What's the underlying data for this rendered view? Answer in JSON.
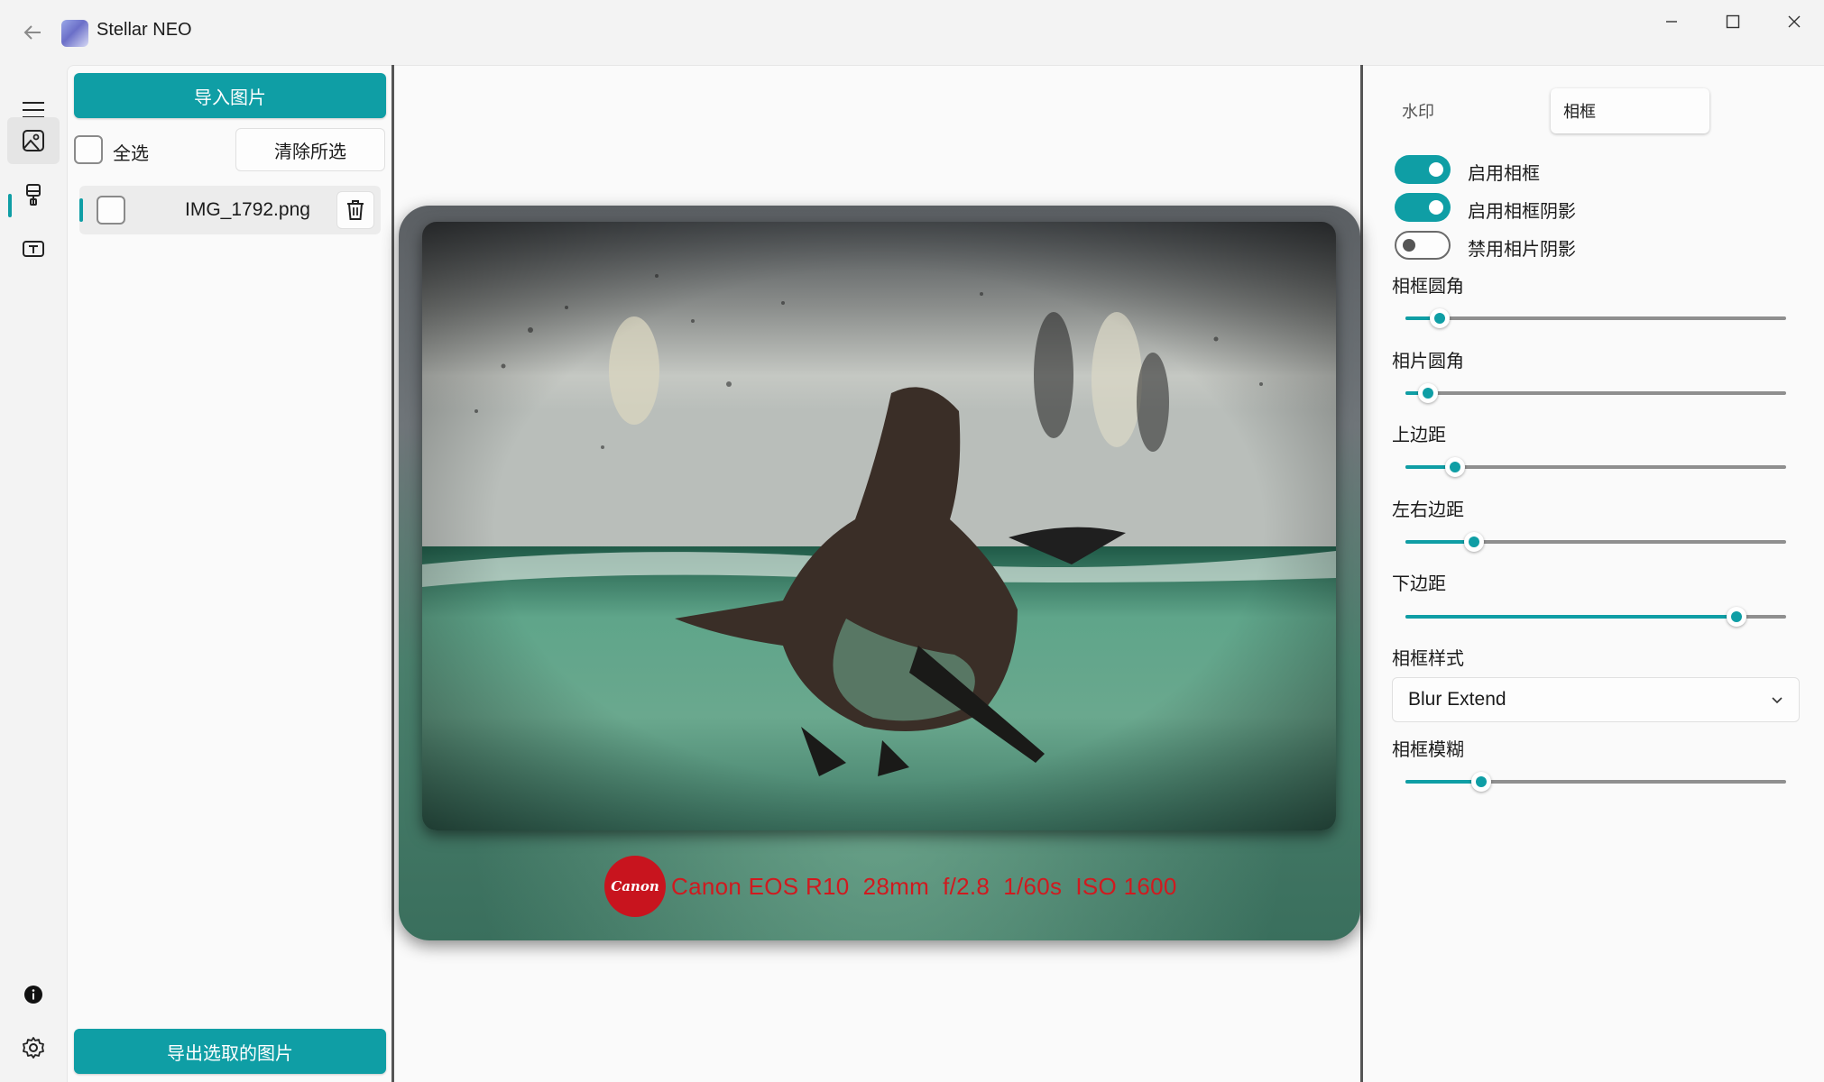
{
  "titlebar": {
    "app_title": "Stellar NEO",
    "icons": [
      "back-arrow-icon",
      "app-icon",
      "minimize-icon",
      "maximize-icon",
      "close-icon"
    ]
  },
  "nav": {
    "items": [
      {
        "name": "menu",
        "icon": "hamburger-icon"
      },
      {
        "name": "image",
        "icon": "image-icon",
        "active": true
      },
      {
        "name": "brush",
        "icon": "brush-icon"
      },
      {
        "name": "text",
        "icon": "text-box-icon"
      },
      {
        "name": "info",
        "icon": "info-icon"
      },
      {
        "name": "settings",
        "icon": "gear-icon"
      }
    ]
  },
  "files": {
    "import_label": "导入图片",
    "select_all_label": "全选",
    "clear_selected_label": "清除所选",
    "items": [
      {
        "name": "IMG_1792.png"
      }
    ],
    "export_label": "导出选取的图片"
  },
  "preview": {
    "watermark_logo": "Canon",
    "watermark_text": "Canon EOS R10  28mm  f/2.8  1/60s  ISO 1600",
    "watermark_color": "#d01a1f"
  },
  "settings": {
    "tabs": [
      {
        "label": "水印",
        "active": false
      },
      {
        "label": "相框",
        "active": true
      }
    ],
    "toggles": [
      {
        "label": "启用相框",
        "on": true
      },
      {
        "label": "启用相框阴影",
        "on": true
      },
      {
        "label": "禁用相片阴影",
        "on": false
      }
    ],
    "sliders": [
      {
        "label": "相框圆角",
        "value": 0.09
      },
      {
        "label": "相片圆角",
        "value": 0.06
      },
      {
        "label": "上边距",
        "value": 0.13
      },
      {
        "label": "左右边距",
        "value": 0.18
      },
      {
        "label": "下边距",
        "value": 0.87
      }
    ],
    "frame_style_label": "相框样式",
    "frame_style_value": "Blur Extend",
    "blur_slider": {
      "label": "相框模糊",
      "value": 0.2
    }
  },
  "colors": {
    "accent": "#0f9ea5"
  }
}
